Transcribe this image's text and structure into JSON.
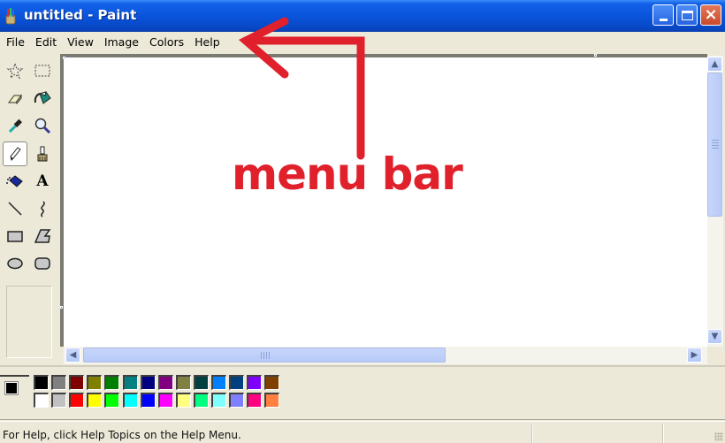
{
  "window": {
    "title": "untitled - Paint",
    "buttons": {
      "minimize": "minimize",
      "maximize": "maximize",
      "close": "×"
    }
  },
  "menubar": {
    "items": [
      {
        "label": "File"
      },
      {
        "label": "Edit"
      },
      {
        "label": "View"
      },
      {
        "label": "Image"
      },
      {
        "label": "Colors"
      },
      {
        "label": "Help"
      }
    ]
  },
  "toolbox": {
    "tools": [
      {
        "name": "free-form-select",
        "icon": "star-select-icon"
      },
      {
        "name": "select",
        "icon": "rect-select-icon"
      },
      {
        "name": "eraser",
        "icon": "eraser-icon"
      },
      {
        "name": "fill-with-color",
        "icon": "paint-bucket-icon"
      },
      {
        "name": "pick-color",
        "icon": "eyedropper-icon"
      },
      {
        "name": "magnifier",
        "icon": "magnifier-icon"
      },
      {
        "name": "pencil",
        "icon": "pencil-icon",
        "active": true
      },
      {
        "name": "brush",
        "icon": "brush-icon"
      },
      {
        "name": "airbrush",
        "icon": "airbrush-icon"
      },
      {
        "name": "text",
        "icon": "text-icon",
        "glyph": "A"
      },
      {
        "name": "line",
        "icon": "line-icon"
      },
      {
        "name": "curve",
        "icon": "curve-icon"
      },
      {
        "name": "rectangle",
        "icon": "rectangle-icon"
      },
      {
        "name": "polygon",
        "icon": "polygon-icon"
      },
      {
        "name": "ellipse",
        "icon": "ellipse-icon"
      },
      {
        "name": "rounded-rectangle",
        "icon": "rounded-rectangle-icon"
      }
    ]
  },
  "palette": {
    "foreground": "#000000",
    "background": "#ffffff",
    "top_row": [
      "#000000",
      "#808080",
      "#800000",
      "#808000",
      "#008000",
      "#008080",
      "#000080",
      "#800080",
      "#808040",
      "#004040",
      "#0080ff",
      "#004080",
      "#8000ff",
      "#804000"
    ],
    "bottom_row": [
      "#ffffff",
      "#c0c0c0",
      "#ff0000",
      "#ffff00",
      "#00ff00",
      "#00ffff",
      "#0000ff",
      "#ff00ff",
      "#ffff80",
      "#00ff80",
      "#80ffff",
      "#8080ff",
      "#ff0080",
      "#ff8040"
    ]
  },
  "statusbar": {
    "text": "For Help, click Help Topics on the Help Menu."
  },
  "annotation": {
    "label": "menu bar",
    "color": "#e0202b"
  }
}
